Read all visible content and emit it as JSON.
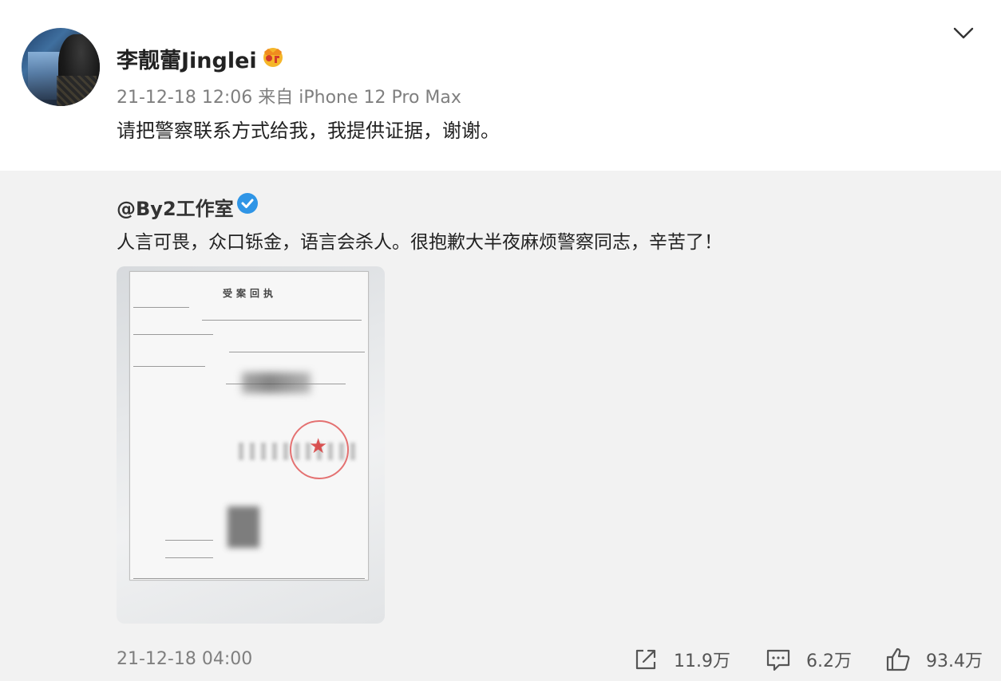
{
  "post": {
    "username": "李靓蕾Jinglei",
    "timestamp": "21-12-18 12:06",
    "source": "来自 iPhone 12 Pro Max",
    "content": "请把警察联系方式给我，我提供证据，谢谢。",
    "icons": {
      "vip": "vip-crown-icon",
      "menu": "chevron-down-icon"
    },
    "colors": {
      "vip": "#f5a623",
      "verified": "#2f95e6"
    }
  },
  "repost": {
    "username": "@By2工作室",
    "content": "人言可畏，众口铄金，语言会杀人。很抱歉大半夜麻烦警察同志，辛苦了！",
    "document_title": "受案回执",
    "timestamp": "21-12-18 04:00",
    "actions": {
      "repost_count": "11.9万",
      "comment_count": "6.2万",
      "like_count": "93.4万"
    }
  }
}
